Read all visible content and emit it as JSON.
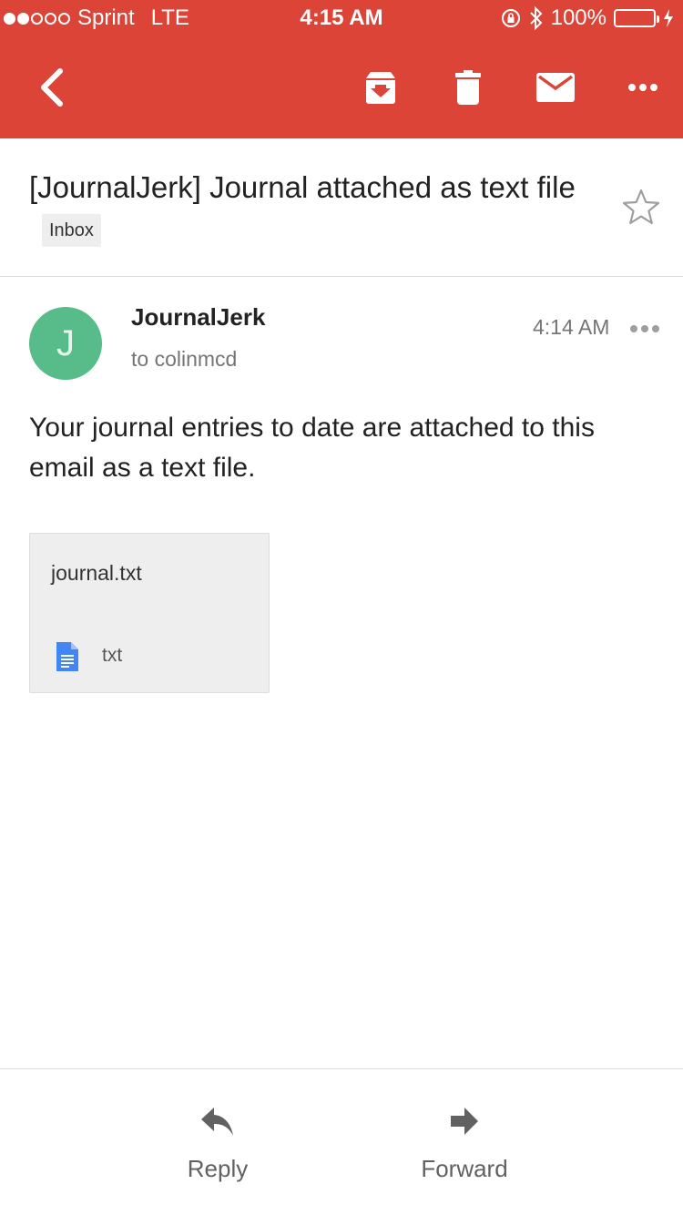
{
  "status_bar": {
    "carrier": "Sprint",
    "network": "LTE",
    "time": "4:15 AM",
    "battery": "100%",
    "signal_bars_filled": 2,
    "signal_bars_total": 5
  },
  "toolbar": {
    "icons": [
      "back-icon",
      "archive-icon",
      "trash-icon",
      "mail-icon",
      "more-icon"
    ]
  },
  "email": {
    "subject": "[JournalJerk] Journal attached as text file",
    "label": "Inbox",
    "avatar_letter": "J",
    "sender": "JournalJerk",
    "recipient": "to colinmcd",
    "time": "4:14 AM",
    "body": "Your journal entries to date are attached to this email as a text file."
  },
  "attachment": {
    "filename": "journal.txt",
    "type": "txt"
  },
  "actions": {
    "reply": "Reply",
    "forward": "Forward"
  },
  "colors": {
    "header": "#db4437",
    "avatar": "#57bb8a",
    "battery": "#4cd964",
    "doc_icon": "#4285f4"
  }
}
